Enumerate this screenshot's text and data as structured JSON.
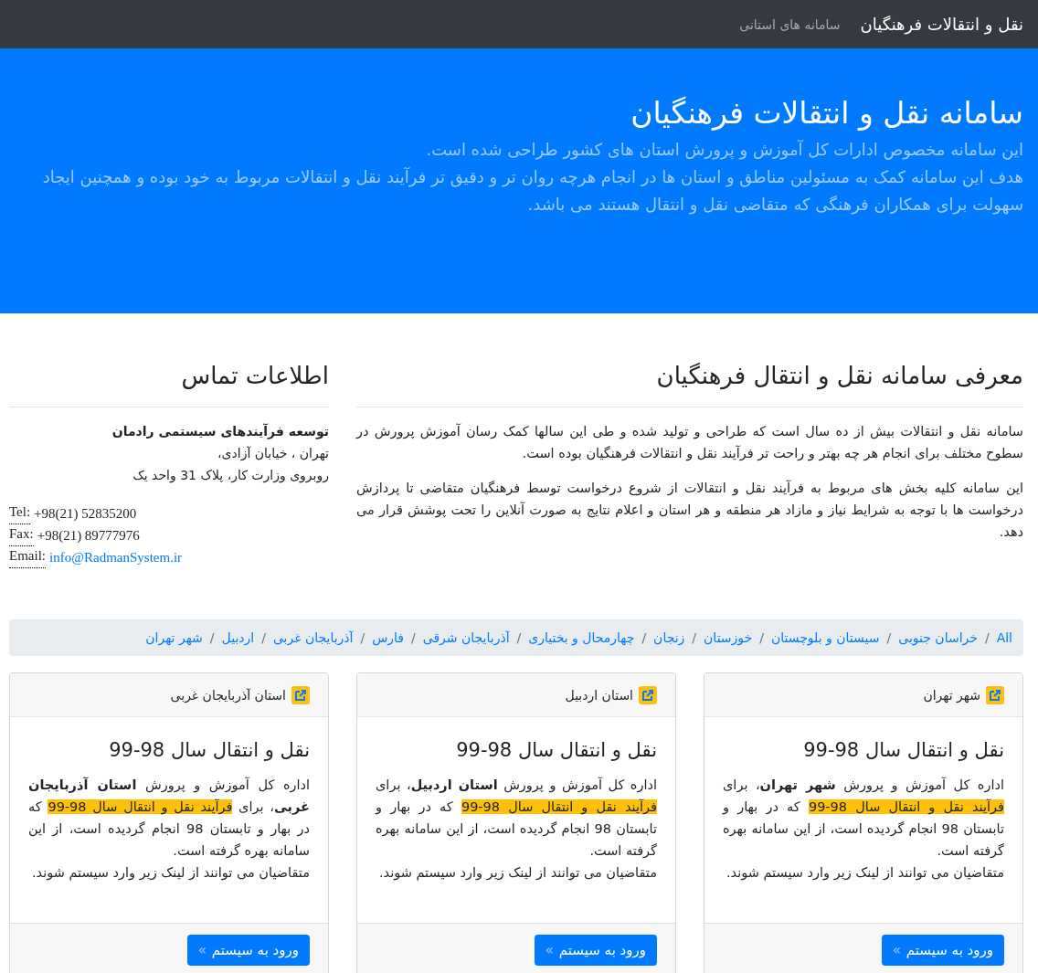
{
  "navbar": {
    "brand": "نقل و انتقالات فرهنگیان",
    "links": [
      {
        "label": "سامانه های استانی"
      }
    ]
  },
  "hero": {
    "title": "سامانه نقل و انتقالات فرهنگیان",
    "lines": [
      "این سامانه مخصوص ادارات کل آموزش و پرورش استان های کشور طراحی شده است.",
      "هدف این سامانه کمک به مسئولین مناطق و استان ها در انجام هرچه روان تر و دقیق تر فرآیند نقل و انتقالات مربوط به خود بوده و همچنین ایجاد سهولت برای همکاران فرهنگی که متقاضی نقل و انتقال هستند می باشد."
    ]
  },
  "intro": {
    "heading": "معرفی سامانه نقل و انتقال فرهنگیان",
    "paragraphs": [
      "سامانه نقل و انتقالات بیش از ده سال است که طراحی و تولید شده و طی این سالها کمک رسان آموزش پرورش در سطوح مختلف برای انجام هر چه بهتر و راحت تر فرآیند نقل و انتقالات فرهنگیان بوده است.",
      "این سامانه کلیه بخش های مربوط به فرآیند نقل و انتقالات از شروع درخواست توسط فرهنگیان متقاضی تا پردازش درخواست ها با توجه به شرایط نیاز و مازاد هر منطقه و هر استان و اعلام نتایج به صورت آنلاین را تحت پوشش قرار می دهد."
    ]
  },
  "contact": {
    "heading": "اطلاعات تماس",
    "company": "توسعه فرآیندهای سیستمی رادمان",
    "address": [
      "تهران ، خیابان آزادی،",
      "روبروی وزارت کار، پلاک 31 واحد یک"
    ],
    "items": [
      {
        "label": "Tel:",
        "value": "+98(21) 52835200",
        "kind": "text"
      },
      {
        "label": "Fax:",
        "value": "+98(21) 89777976",
        "kind": "text"
      },
      {
        "label": "Email:",
        "value": "info@RadmanSystem.ir",
        "kind": "link"
      }
    ]
  },
  "breadcrumb_separator": "/",
  "breadcrumb": [
    {
      "label": "All"
    },
    {
      "label": "خراسان جنوبی"
    },
    {
      "label": "سیستان و بلوچستان"
    },
    {
      "label": "خوزستان"
    },
    {
      "label": "زنجان"
    },
    {
      "label": "چهارمحال و بختیاری"
    },
    {
      "label": "آذربایجان شرقی"
    },
    {
      "label": "فارس"
    },
    {
      "label": "آذربایجان غربی"
    },
    {
      "label": "اردبیل"
    },
    {
      "label": "شهر تهران"
    }
  ],
  "cards": [
    {
      "header": "شهر تهران",
      "title": "نقل و انتقال سال 98-99",
      "before": "اداره کل آموزش و پرورش **شهر تهران**، برای ",
      "highlight": "فرآیند نقل و انتقال سال 98-99",
      "after": " که در بهار و تابستان 98 انجام گردیده است، از این سامانه بهره گرفته است.",
      "note": "متقاضیان می توانند از لینک زیر وارد سیستم شوند.",
      "button": "ورود به سیستم",
      "button_arrow": "»"
    },
    {
      "header": "استان اردبیل",
      "title": "نقل و انتقال سال 98-99",
      "before": "اداره کل آموزش و پرورش **استان اردبیل**، برای ",
      "highlight": "فرآیند نقل و انتقال سال 98-99",
      "after": " که در بهار و تابستان 98 انجام گردیده است، از این سامانه بهره گرفته است.",
      "note": "متقاضیان می توانند از لینک زیر وارد سیستم شوند.",
      "button": "ورود به سیستم",
      "button_arrow": "»"
    },
    {
      "header": "استان آذربایجان غربی",
      "title": "نقل و انتقال سال 98-99",
      "before": "اداره کل آموزش و پرورش **استان آذربایجان غربی**، برای ",
      "highlight": "فرآیند نقل و انتقال سال 98-99",
      "after": " که در بهار و تابستان 98 انجام گردیده است، از این سامانه بهره گرفته است.",
      "note": "متقاضیان می توانند از لینک زیر وارد سیستم شوند.",
      "button": "ورود به سیستم",
      "button_arrow": "»"
    }
  ]
}
